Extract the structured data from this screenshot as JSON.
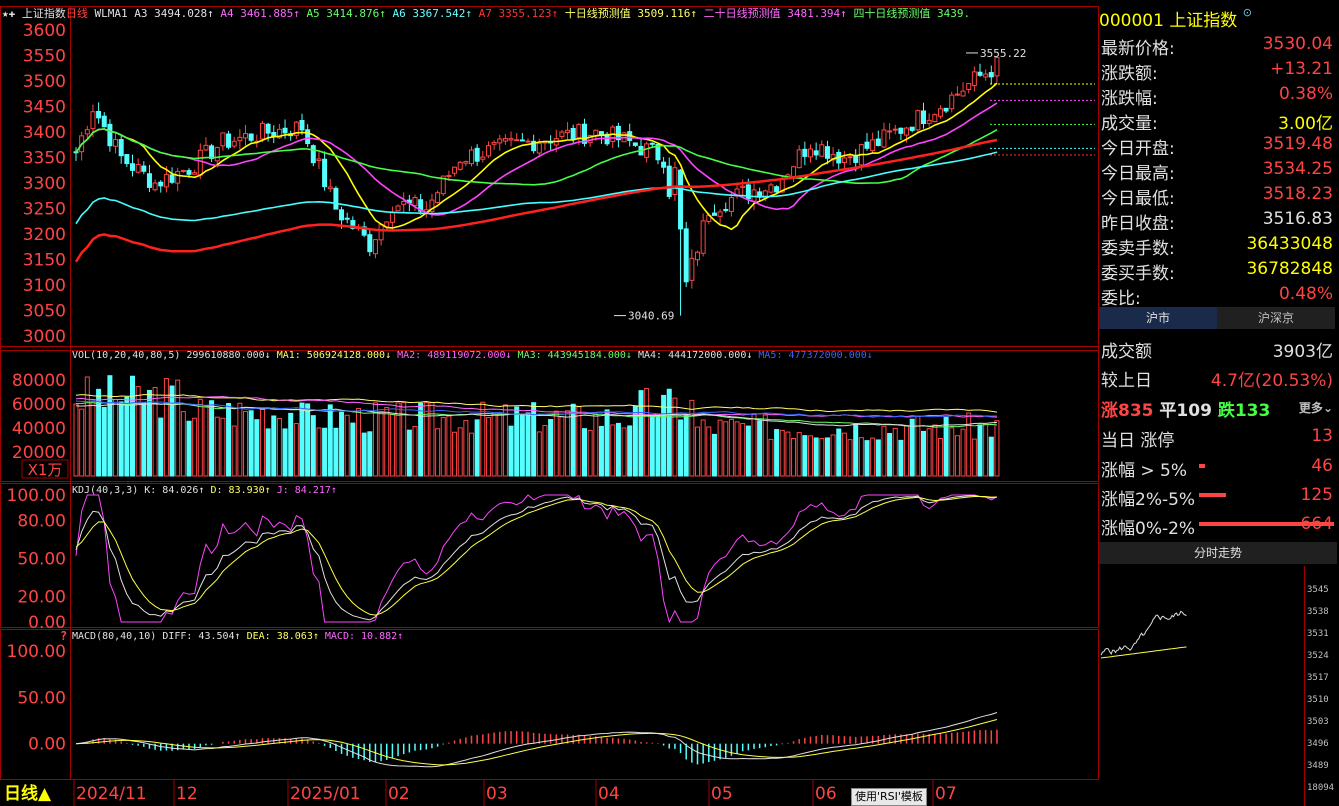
{
  "chart": {
    "title": "上证指数",
    "period": "日线",
    "ma_legend": [
      {
        "label": "WLMA1",
        "value": "",
        "color": "#e0e0e0"
      },
      {
        "label": "A3",
        "value": "3494.028↑",
        "color": "#e0e0e0"
      },
      {
        "label": "A4",
        "value": "3461.885↑",
        "color": "#ff66ff"
      },
      {
        "label": "A5",
        "value": "3414.876↑",
        "color": "#66ff66"
      },
      {
        "label": "A6",
        "value": "3367.542↑",
        "color": "#66ffff"
      },
      {
        "label": "A7",
        "value": "3355.123↑",
        "color": "#ff3333"
      },
      {
        "label": "十日线预测值",
        "value": "3509.116↑",
        "color": "#ffff66"
      },
      {
        "label": "二十日线预测值",
        "value": "3481.394↑",
        "color": "#ff66ff"
      },
      {
        "label": "四十日线预测值",
        "value": "3439.",
        "color": "#66ff66"
      }
    ],
    "price_axis": [
      "3600",
      "3550",
      "3500",
      "3450",
      "3400",
      "3350",
      "3300",
      "3250",
      "3200",
      "3150",
      "3100",
      "3050",
      "3000"
    ],
    "high_marker": "3555.22",
    "low_marker": "3040.69",
    "vol_legend": "VOL(10,20,40,80,5)",
    "vol_values": [
      {
        "label": "",
        "value": "299610880.000↓",
        "color": "#e0e0e0"
      },
      {
        "label": "MA1:",
        "value": "506924128.000↓",
        "color": "#ffff66"
      },
      {
        "label": "MA2:",
        "value": "489119072.000↓",
        "color": "#ff66ff"
      },
      {
        "label": "MA3:",
        "value": "443945184.000↓",
        "color": "#66ff66"
      },
      {
        "label": "MA4:",
        "value": "444172000.000↓",
        "color": "#e0e0e0"
      },
      {
        "label": "MA5:",
        "value": "477372000.000↓",
        "color": "#3366ff"
      }
    ],
    "vol_axis": [
      "80000",
      "60000",
      "40000",
      "20000"
    ],
    "vol_unit": "X1万",
    "kdj_legend": "KDJ(40,3,3)",
    "kdj_values": [
      {
        "label": "K:",
        "value": "84.026↑",
        "color": "#e0e0e0"
      },
      {
        "label": "D:",
        "value": "83.930↑",
        "color": "#ffff66"
      },
      {
        "label": "J:",
        "value": "84.217↑",
        "color": "#ff66ff"
      }
    ],
    "kdj_axis": [
      "100.00",
      "80.00",
      "50.00",
      "20.00",
      "0.00"
    ],
    "macd_legend": "MACD(80,40,10)",
    "macd_values": [
      {
        "label": "DIFF:",
        "value": "43.504↑",
        "color": "#e0e0e0"
      },
      {
        "label": "DEA:",
        "value": "38.063↑",
        "color": "#ffff66"
      },
      {
        "label": "MACD:",
        "value": "10.882↑",
        "color": "#ff66ff"
      }
    ],
    "macd_axis": [
      "100.00",
      "50.00",
      "0.00"
    ],
    "period_button": "日线▲",
    "x_labels": [
      "2024/11",
      "12",
      "2025/01",
      "02",
      "03",
      "04",
      "05",
      "06",
      "07"
    ],
    "template_button": "使用'RSI'模板"
  },
  "quote": {
    "code": "000001",
    "name": "上证指数",
    "rows": [
      {
        "label": "最新价格:",
        "value": "3530.04",
        "color": "#ff4444"
      },
      {
        "label": "涨跌额:",
        "value": "+13.21",
        "color": "#ff4444"
      },
      {
        "label": "涨跌幅:",
        "value": "0.38%",
        "color": "#ff4444"
      },
      {
        "label": "成交量:",
        "value": "3.00亿",
        "color": "#ffff00"
      },
      {
        "label": "今日开盘:",
        "value": "3519.48",
        "color": "#ff4444"
      },
      {
        "label": "今日最高:",
        "value": "3534.25",
        "color": "#ff4444"
      },
      {
        "label": "今日最低:",
        "value": "3518.23",
        "color": "#ff4444"
      },
      {
        "label": "昨日收盘:",
        "value": "3516.83",
        "color": "#e0e0e0"
      },
      {
        "label": "委卖手数:",
        "value": "36433048",
        "color": "#ffff00"
      },
      {
        "label": "委买手数:",
        "value": "36782848",
        "color": "#ffff00"
      },
      {
        "label": "委比:",
        "value": "0.48%",
        "color": "#ff4444"
      }
    ]
  },
  "market": {
    "tab_active": "沪市",
    "tab_other": "沪深京",
    "turnover_label": "成交额",
    "turnover_value": "3903亿",
    "compare_label": "较上日",
    "compare_value": "4.7亿(20.53%)",
    "up_label": "涨",
    "up_value": "835",
    "flat_label": "平",
    "flat_value": "109",
    "down_label": "跌",
    "down_value": "133",
    "more": "更多",
    "limit_label": "当日 涨停",
    "limit_value": "13",
    "bars": [
      {
        "label": "涨幅 > 5%",
        "value": "46",
        "bar": 0.02
      },
      {
        "label": "涨幅2%-5%",
        "value": "125",
        "bar": 0.09
      },
      {
        "label": "涨幅0%-2%",
        "value": "664",
        "bar": 0.45
      }
    ]
  },
  "intraday": {
    "title": "分时走势",
    "axis": [
      "3545",
      "3538",
      "3531",
      "3524",
      "3517",
      "3510",
      "3503",
      "3496",
      "3489",
      "18094"
    ]
  }
}
